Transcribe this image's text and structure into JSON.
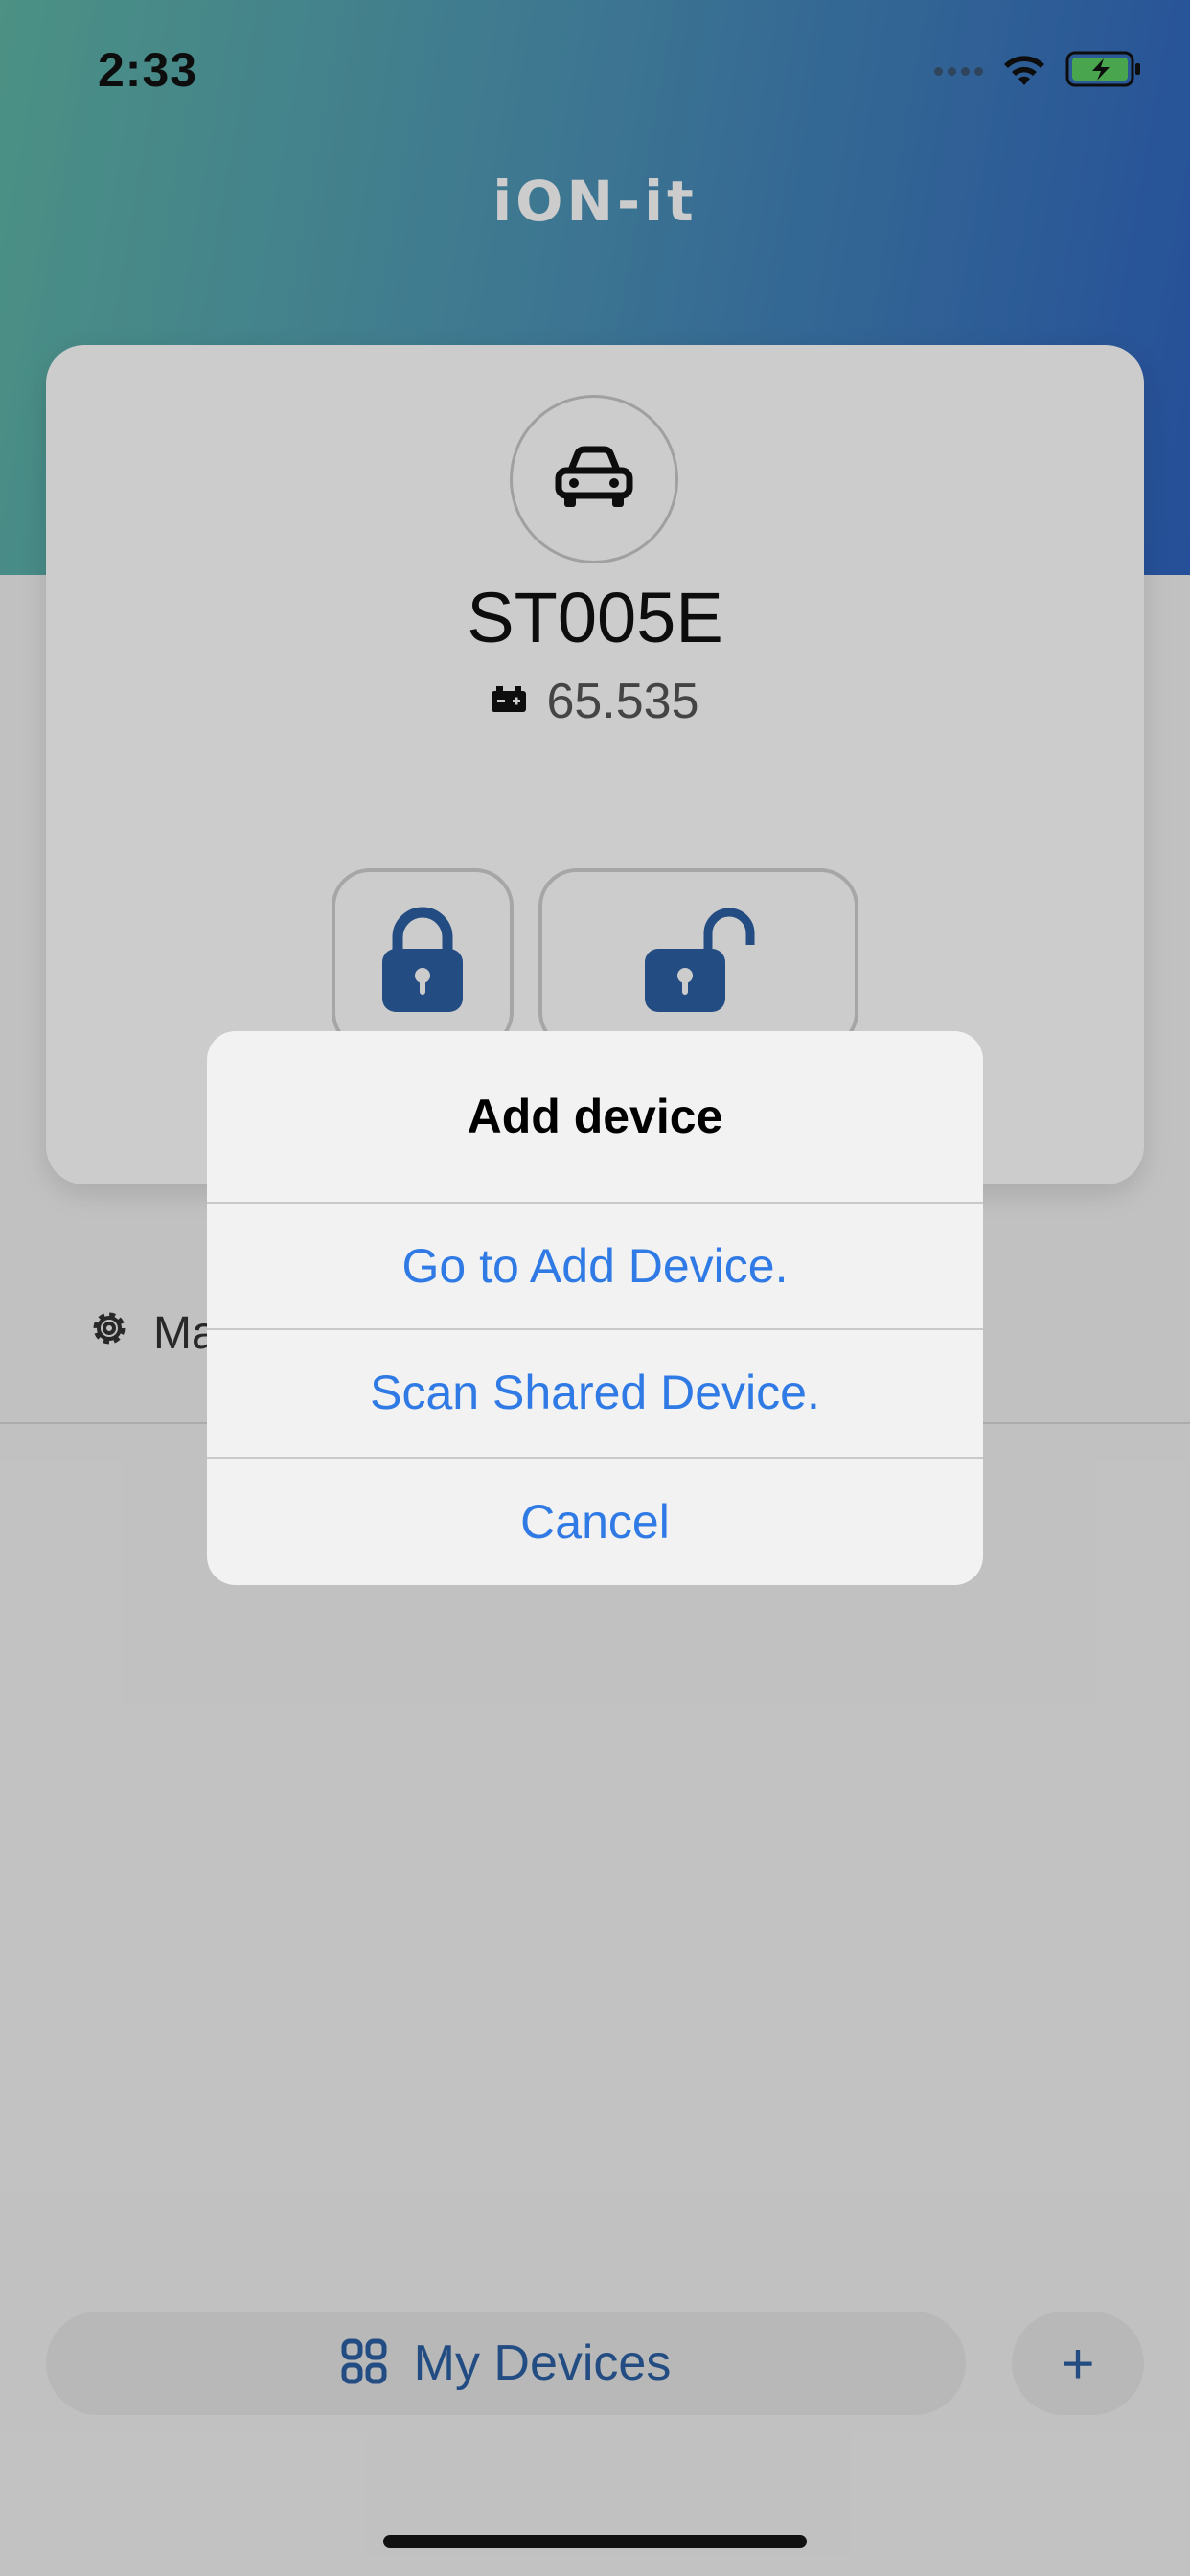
{
  "status_bar": {
    "time": "2:33"
  },
  "app": {
    "title": "iON-it"
  },
  "device_card": {
    "name": "ST005E",
    "battery_value": "65.535",
    "car_icon": "car-icon",
    "lock_icon": "lock-closed-icon",
    "unlock_icon": "lock-open-icon"
  },
  "manage": {
    "label_visible": "Ma"
  },
  "bottom_bar": {
    "my_devices_label": "My Devices",
    "add_label": "+"
  },
  "alert": {
    "title": "Add device",
    "actions": [
      "Go to Add Device.",
      "Scan Shared Device.",
      "Cancel"
    ]
  },
  "colors": {
    "accent_blue": "#2f7ae5",
    "brand_blue": "#2b5fa3",
    "gradient_start": "#5fb6a6",
    "gradient_end": "#2f63bf",
    "battery_green": "#5ccf62"
  }
}
